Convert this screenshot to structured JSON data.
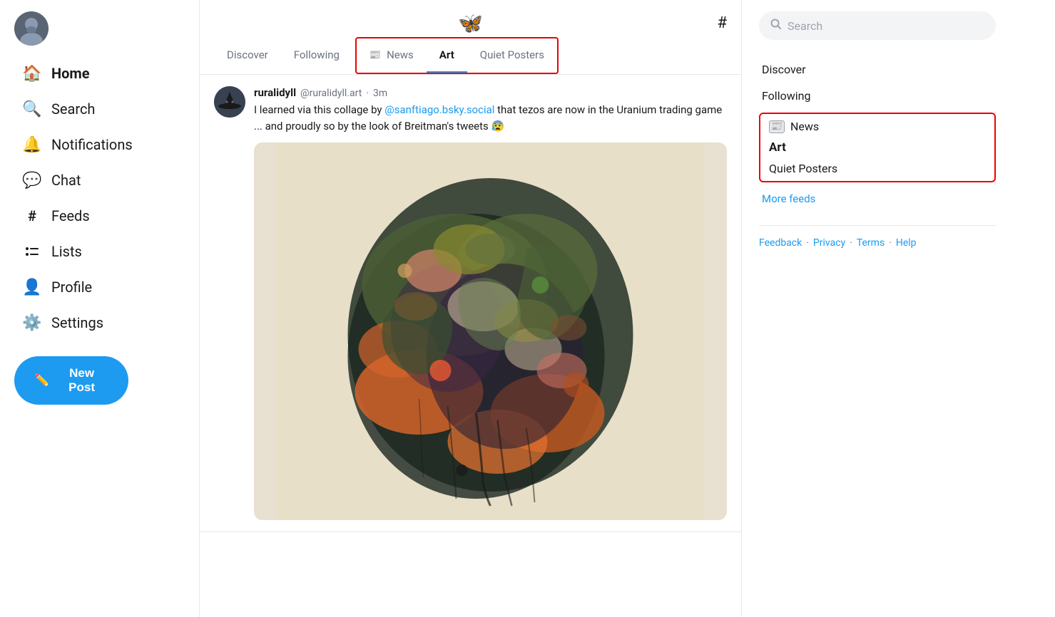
{
  "sidebar": {
    "nav_items": [
      {
        "id": "home",
        "label": "Home",
        "icon": "🏠",
        "active": true
      },
      {
        "id": "search",
        "label": "Search",
        "icon": "🔍",
        "active": false
      },
      {
        "id": "notifications",
        "label": "Notifications",
        "icon": "🔔",
        "active": false
      },
      {
        "id": "chat",
        "label": "Chat",
        "icon": "💬",
        "active": false
      },
      {
        "id": "feeds",
        "label": "Feeds",
        "icon": "#",
        "active": false
      },
      {
        "id": "lists",
        "label": "Lists",
        "icon": "≡",
        "active": false
      },
      {
        "id": "profile",
        "label": "Profile",
        "icon": "👤",
        "active": false
      },
      {
        "id": "settings",
        "label": "Settings",
        "icon": "⚙️",
        "active": false
      }
    ],
    "new_post_label": "New Post"
  },
  "topbar": {
    "logo": "🦋",
    "hash_icon": "#"
  },
  "tabs": {
    "items": [
      {
        "id": "discover",
        "label": "Discover",
        "active": false,
        "highlighted": false
      },
      {
        "id": "following",
        "label": "Following",
        "active": false,
        "highlighted": false
      },
      {
        "id": "news",
        "label": "News",
        "active": false,
        "highlighted": true,
        "has_icon": true
      },
      {
        "id": "art",
        "label": "Art",
        "active": true,
        "highlighted": true
      },
      {
        "id": "quiet-posters",
        "label": "Quiet Posters",
        "active": false,
        "highlighted": true
      }
    ]
  },
  "post": {
    "avatar_emoji": "🎩",
    "display_name": "ruralidyll",
    "handle": "@ruralidyll.art",
    "dot": "·",
    "time": "3m",
    "text_before": "I learned via this collage by ",
    "mention": "@sanftiago.bsky.social",
    "text_after": " that tezos are now in the Uranium trading game ... and proudly so by the look of Breitman's tweets 😰"
  },
  "right_sidebar": {
    "search_placeholder": "Search",
    "nav_items": [
      {
        "id": "discover",
        "label": "Discover"
      },
      {
        "id": "following",
        "label": "Following"
      }
    ],
    "feeds": [
      {
        "id": "news",
        "label": "News",
        "has_icon": true,
        "bold": false
      },
      {
        "id": "art",
        "label": "Art",
        "has_icon": false,
        "bold": true
      },
      {
        "id": "quiet-posters",
        "label": "Quiet Posters",
        "has_icon": false,
        "bold": false
      }
    ],
    "more_feeds_label": "More feeds",
    "footer": {
      "links": [
        "Feedback",
        "Privacy",
        "Terms",
        "Help"
      ],
      "separator": "·"
    }
  }
}
